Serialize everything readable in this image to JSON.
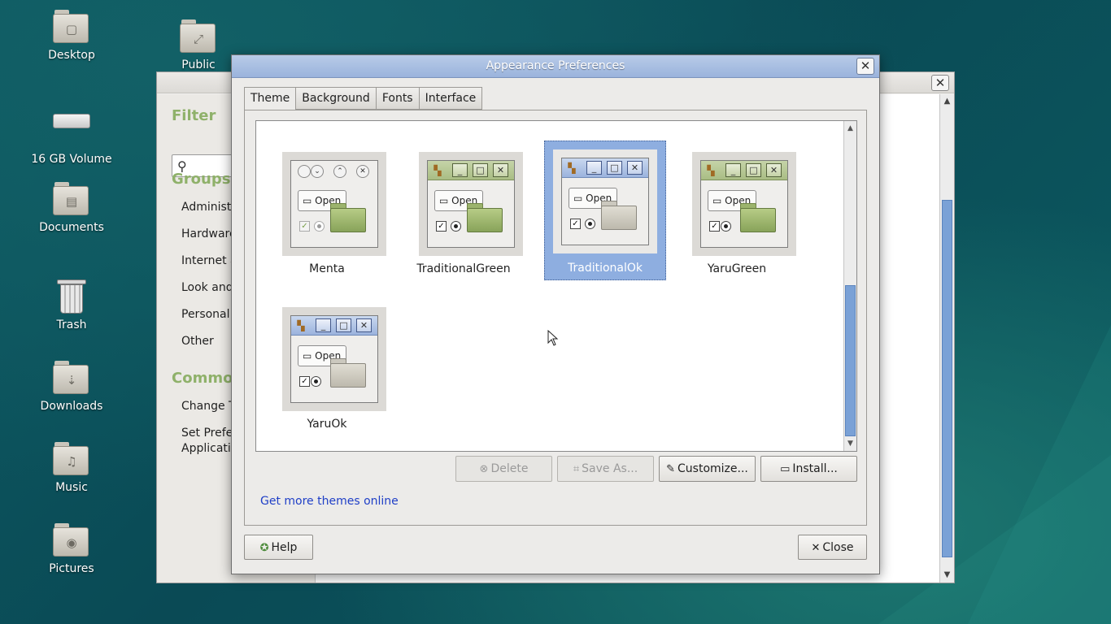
{
  "desktop": {
    "icons": [
      {
        "label": "Desktop",
        "icon": "folder-desktop-icon"
      },
      {
        "label": "Public",
        "icon": "folder-public-icon"
      },
      {
        "label": "16 GB Volume",
        "icon": "drive-icon"
      },
      {
        "label": "Documents",
        "icon": "folder-documents-icon"
      },
      {
        "label": "Trash",
        "icon": "trash-icon"
      },
      {
        "label": "Downloads",
        "icon": "folder-downloads-icon"
      },
      {
        "label": "Music",
        "icon": "folder-music-icon"
      },
      {
        "label": "Pictures",
        "icon": "folder-pictures-icon"
      }
    ]
  },
  "control_center": {
    "filter_heading": "Filter",
    "groups_heading": "Groups",
    "groups": [
      "Administr",
      "Hardware",
      "Internet a",
      "Look and",
      "Personal",
      "Other"
    ],
    "common_heading": "Common",
    "common_items": [
      "Change T",
      "Set Prefe",
      "Applicatio"
    ]
  },
  "dialog": {
    "title": "Appearance Preferences",
    "tabs": [
      "Theme",
      "Background",
      "Fonts",
      "Interface"
    ],
    "active_tab": "Theme",
    "themes": [
      {
        "name": "Menta",
        "style": "menta",
        "selected": false
      },
      {
        "name": "TraditionalGreen",
        "style": "green",
        "selected": false
      },
      {
        "name": "TraditionalOk",
        "style": "ok",
        "selected": true
      },
      {
        "name": "YaruGreen",
        "style": "green",
        "selected": false
      },
      {
        "name": "YaruOk",
        "style": "ok",
        "selected": false
      }
    ],
    "preview_button_label": "Open",
    "buttons": {
      "delete": "Delete",
      "save_as": "Save As...",
      "customize": "Customize...",
      "install": "Install..."
    },
    "more_themes_link": "Get more themes online",
    "help": "Help",
    "close": "Close"
  },
  "colors": {
    "selection": "#8eaee0",
    "link": "#1f3fc7",
    "title_bar": "#9ab3dc",
    "group_heading": "#8fb16a"
  }
}
